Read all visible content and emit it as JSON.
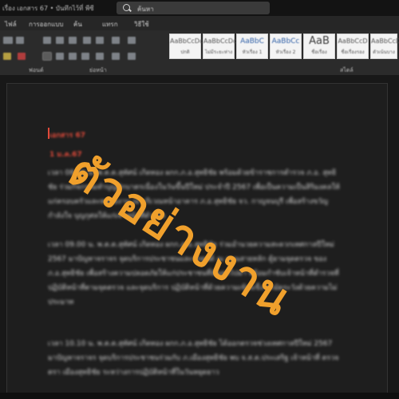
{
  "window": {
    "title": "เรื่อง เอกสาร 67 • บันทึกไว้ที่ พีซี",
    "search_placeholder": "ค้นหา"
  },
  "ribbon": {
    "tabs": [
      "ไฟล์",
      "การออกแบบ",
      "ค้น",
      "แทรก",
      "วิธีใช้"
    ],
    "groups": [
      "ฟอนต์",
      "ย่อหน้า",
      "สไตล์"
    ],
    "styles": [
      {
        "sample": "AaBbCcDc",
        "name": "ปกติ"
      },
      {
        "sample": "AaBbCcDc",
        "name": "ไม่มีระยะห่าง"
      },
      {
        "sample": "AaBbC",
        "name": "หัวเรื่อง 1"
      },
      {
        "sample": "AaBbCc",
        "name": "หัวเรื่อง 2"
      },
      {
        "sample": "AaB",
        "name": "ชื่อเรื่อง"
      },
      {
        "sample": "AaBbCcD",
        "name": "ชื่อเรื่องรอง"
      },
      {
        "sample": "AaBbCcDc",
        "name": "ตัวเน้นบาง"
      }
    ]
  },
  "document": {
    "heading1": "เอกสาร 67",
    "heading2": "1 ม.ค.67",
    "paragraphs": [
      "เวลา 08.00 น. พ.ต.ต.สุทัศน์ เกิดทอง ผกก.ภ.อ.สุทธิชัย พร้อมด้วยข้าราชการตำรวจ ภ.อ. สุทธิชัย ร่วมกิจกรรมทำบุญตักบาตรเนื่องในวันขึ้นปีใหม่ ประจำปี 2567 เพื่อเป็นความเป็นสิริมงคลให้แก่ครอบครัวและหน่วยงาน ณ บริเวณหน้าอาคาร ภ.อ.สุทธิชัย จว. กาญจนบุรี เพื่อสร้างขวัญกำลังใจ บุญกุศลให้แก่เจ้าหน้าที่ตำรวจ",
      "เวลา 09.00 น. พ.ต.ต.สุทัศน์ เกิดทอง ผกก.ภ.อ.สุทธิชัย ร่วมอำนวยความสะดวกเทศกาลปีใหม่ 2567 มาปัญหาจราจร จุดบริการประชาชนและรถยนต์ ณ ถนนสายหลัก ตู้ยามจุดตรวจ ของ ภ.อ.สุทธิชัย เพื่อสร้างความปลอดภัยให้แก่ประชาชนที่สัญจรไปมา พร้อมกำชับเจ้าหน้าที่ตำรวจที่ปฏิบัติหน้าที่ตามจุดตรวจ และจุดบริการ ปฏิบัติหน้าที่ด้วยความเข้มแข็ง ระมัดระวังด้วยความไม่ประมาท",
      "เวลา 10.10 น. พ.ต.ต.สุทัศน์ เกิดทอง ผกก.ภ.อ.สุทธิชัย ได้ออกตรวจช่วงเทศกาลปีใหม่ 2567 มาปัญหาจราจร จุดบริการประชาชนร่วมกับ ภ.เมืองสุทธิชัย พบ จ.ส.ต.ประเสริฐ เจ้าหน้าที่ ตรวจตรา เมืองสุทธิชัย ระหว่างการปฏิบัติหน้าที่ในวันหยุดยาว"
    ]
  },
  "watermark_text": "ตัวอย่างงาน",
  "colors": {
    "heading_red": "#e04a3a",
    "watermark_orange": "#f0a02c",
    "background": "#1b1b1b"
  }
}
